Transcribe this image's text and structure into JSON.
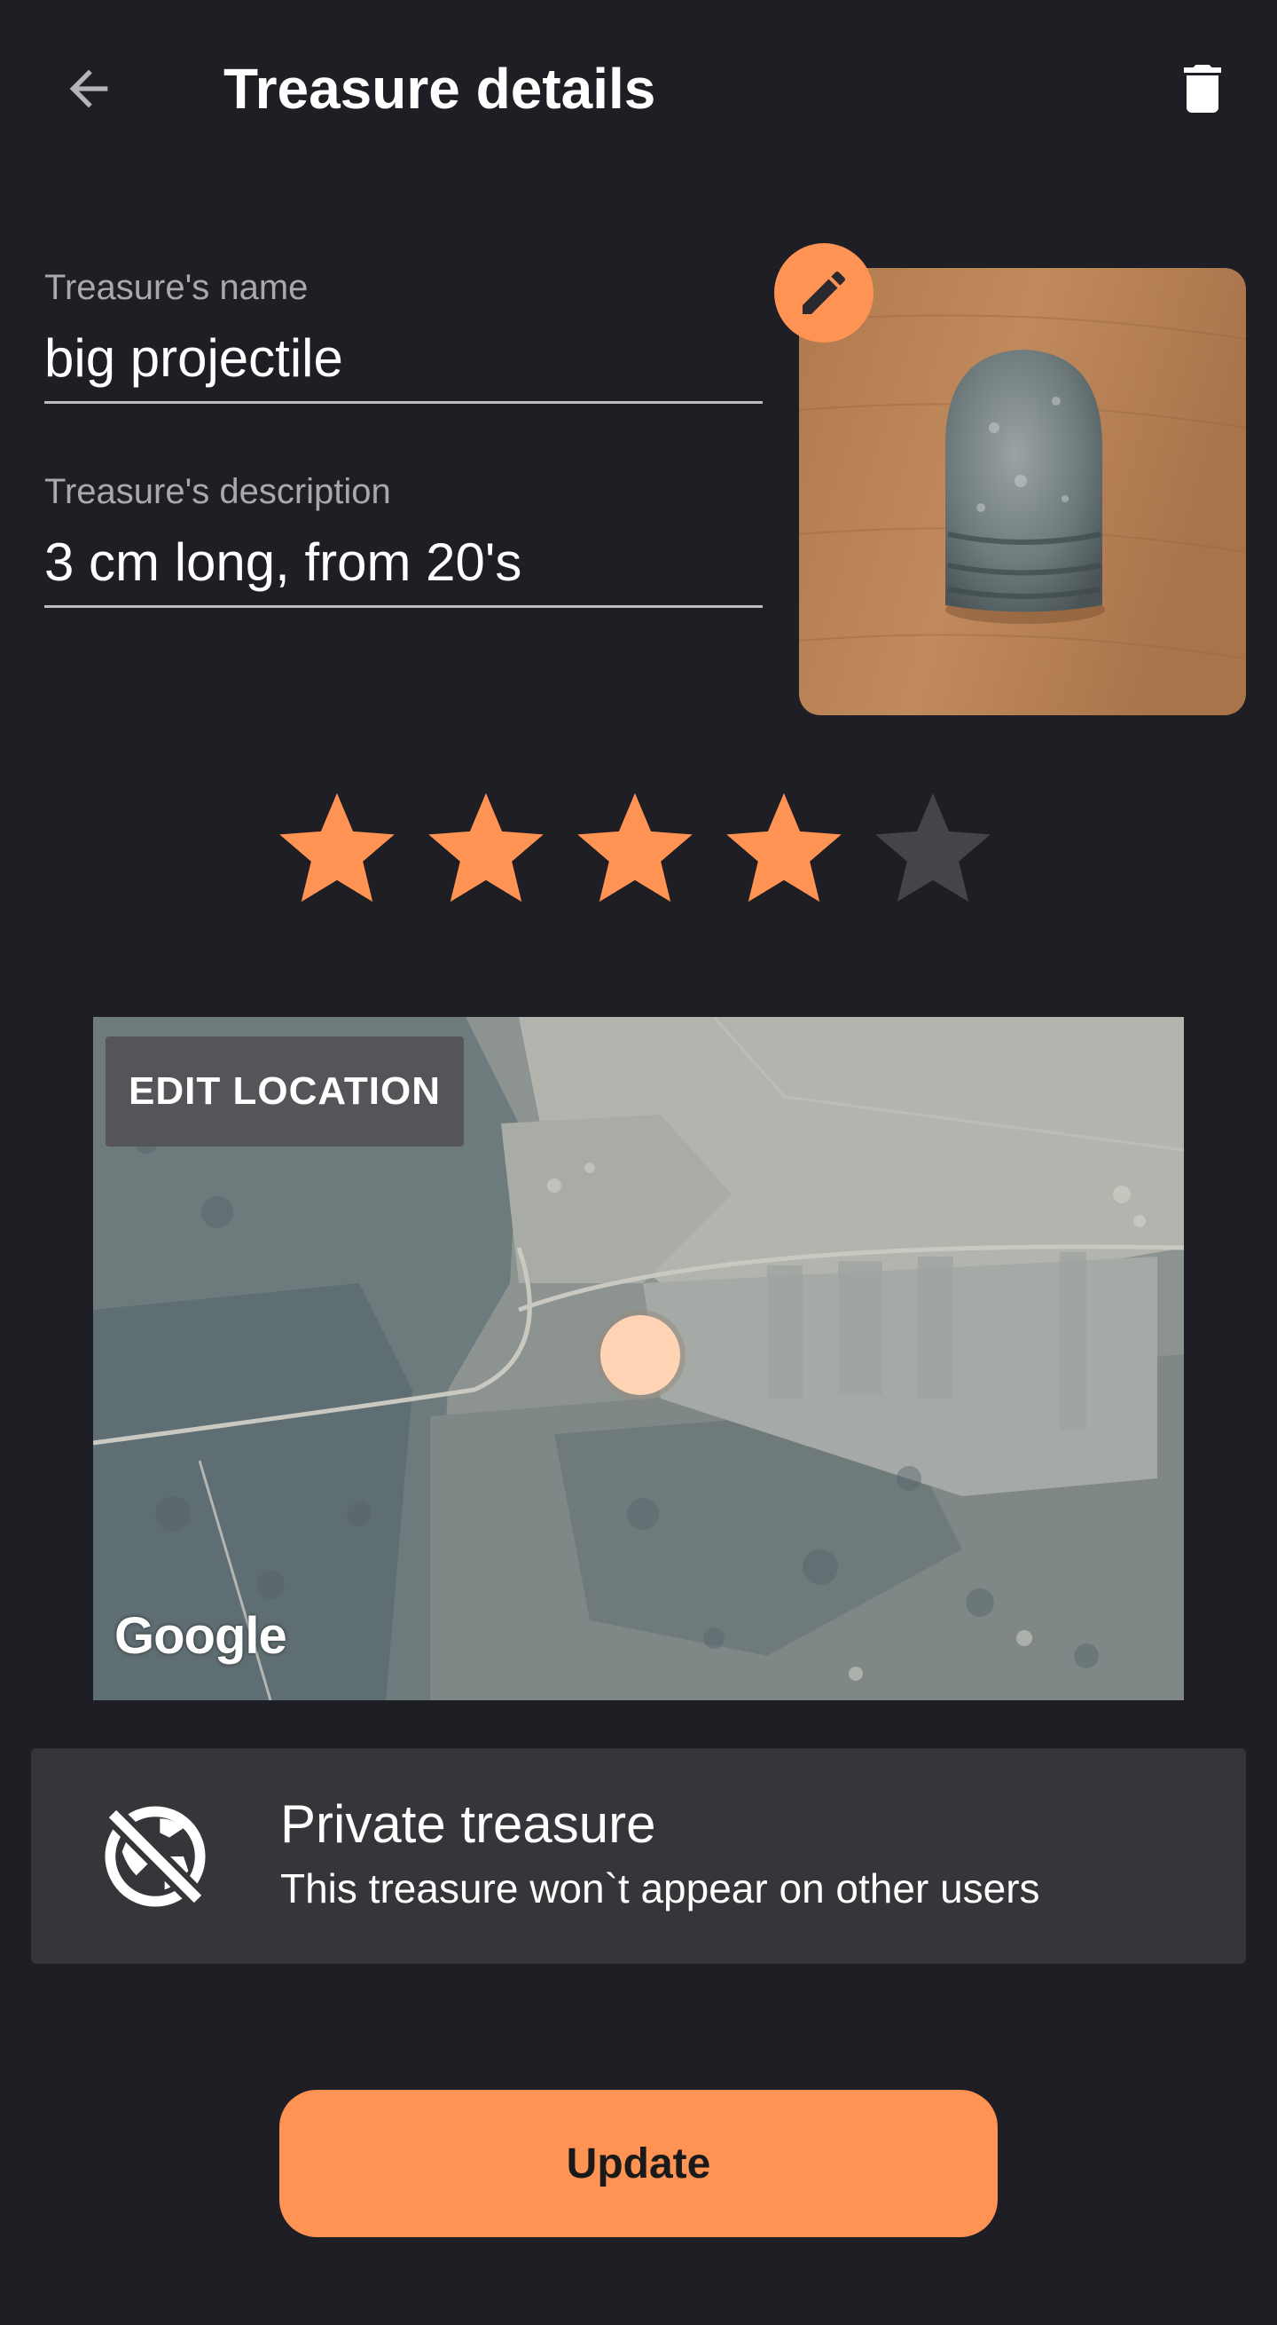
{
  "appbar": {
    "title": "Treasure details",
    "back_icon": "arrow-back-icon",
    "delete_icon": "trash-icon"
  },
  "form": {
    "name_label": "Treasure's name",
    "name_value": "big projectile",
    "description_label": "Treasure's description",
    "description_value": "3 cm long, from 20's"
  },
  "photo": {
    "edit_icon": "pencil-icon"
  },
  "rating": {
    "value": 4,
    "max": 5,
    "filled_color": "#ff9353",
    "empty_color": "#45444a"
  },
  "map": {
    "edit_location_label": "EDIT LOCATION",
    "provider_logo": "Google"
  },
  "privacy": {
    "icon": "public-off-icon",
    "title": "Private treasure",
    "subtitle": "This treasure won`t appear on other users"
  },
  "update_button": {
    "label": "Update"
  },
  "colors": {
    "background": "#1f1e24",
    "accent": "#ff9353",
    "card": "#363539"
  }
}
